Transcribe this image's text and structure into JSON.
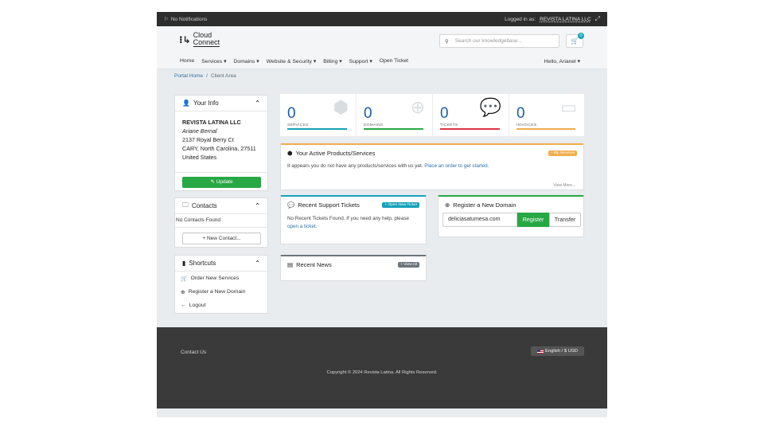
{
  "topbar": {
    "notifications": "No Notifications",
    "logged_in_as": "Logged in as:",
    "account": "REVISTA LATINA LLC"
  },
  "brand": {
    "line1": "Cloud",
    "line2": "Connect"
  },
  "search": {
    "placeholder": "Search our knowledgebase..."
  },
  "cart": {
    "count": "0"
  },
  "nav": {
    "items": [
      "Home",
      "Services ▾",
      "Domains ▾",
      "Website & Security ▾",
      "Billing ▾",
      "Support ▾",
      "Open Ticket"
    ],
    "greeting": "Hello, Arianel ▾"
  },
  "breadcrumb": {
    "home": "Portal Home",
    "sep": "/",
    "current": "Client Area"
  },
  "your_info": {
    "title": "Your Info",
    "company": "REVISTA LATINA LLC",
    "person": "Ariane Bernal",
    "address1": "2137 Royal Berry Ct",
    "address2": "CARY, North Carolina, 27511",
    "country": "United States",
    "update_label": "Update"
  },
  "contacts": {
    "title": "Contacts",
    "empty": "No Contacts Found",
    "new_label": "New Contact..."
  },
  "shortcuts": {
    "title": "Shortcuts",
    "items": [
      "Order New Services",
      "Register a New Domain",
      "Logout"
    ]
  },
  "stats": [
    {
      "value": "0",
      "label": "SERVICES",
      "color": "#17a2b8"
    },
    {
      "value": "0",
      "label": "DOMAINS",
      "color": "#28a745"
    },
    {
      "value": "0",
      "label": "TICKETS",
      "color": "#dc3545"
    },
    {
      "value": "0",
      "label": "INVOICES",
      "color": "#f0ad4e"
    }
  ],
  "products": {
    "title": "Your Active Products/Services",
    "button": "My Services",
    "message": "It appears you do not have any products/services with us yet.",
    "link": "Place an order to get started.",
    "view_more": "View More..."
  },
  "tickets": {
    "title": "Recent Support Tickets",
    "button": "Open New Ticket",
    "message": "No Recent Tickets Found. If you need any help, please",
    "link": "open a ticket."
  },
  "domain_reg": {
    "title": "Register a New Domain",
    "input_value": "deliciasatumesa.com",
    "register_label": "Register",
    "transfer_label": "Transfer"
  },
  "news": {
    "title": "Recent News",
    "button": "View All"
  },
  "footer": {
    "contact": "Contact Us",
    "language": "English / $ USD",
    "copyright": "Copyright © 2024 Revista Latina. All Rights Reserved."
  },
  "colors": {
    "green": "#28a745",
    "blue": "#1a5ea8",
    "info": "#17a2b8",
    "warning": "#f0ad4e"
  }
}
